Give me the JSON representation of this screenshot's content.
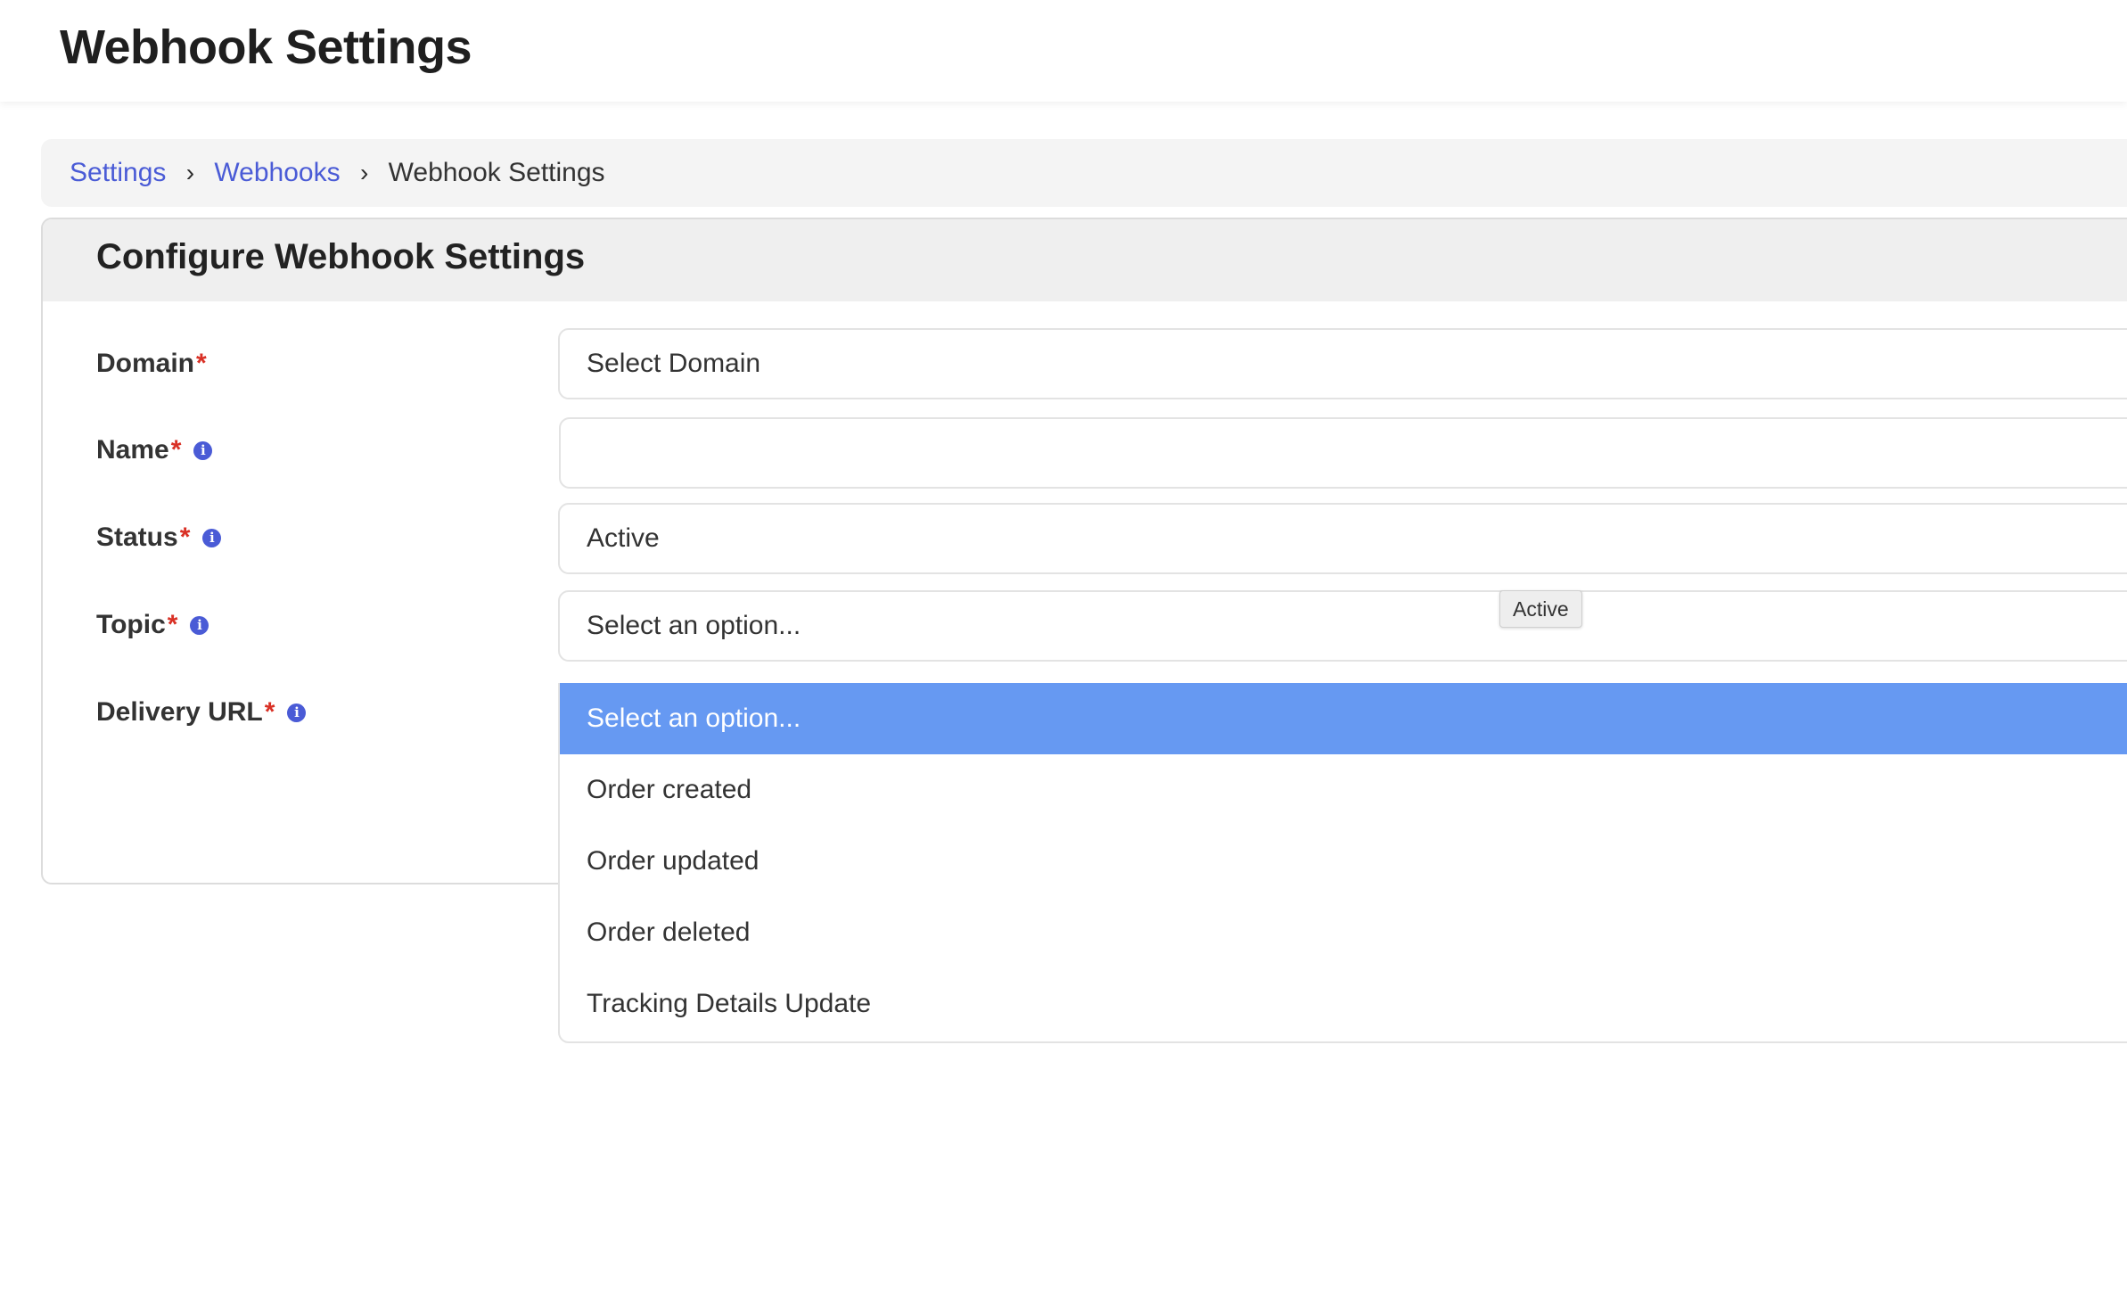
{
  "header": {
    "title": "Webhook Settings"
  },
  "breadcrumb": {
    "items": [
      {
        "label": "Settings",
        "link": true
      },
      {
        "label": "Webhooks",
        "link": true
      },
      {
        "label": "Webhook Settings",
        "link": false
      }
    ],
    "separator": "›"
  },
  "card": {
    "title": "Configure Webhook Settings"
  },
  "form": {
    "required_marker": "*",
    "info_glyph": "i",
    "fields": {
      "domain": {
        "label": "Domain",
        "value": "Select Domain"
      },
      "name": {
        "label": "Name",
        "value": ""
      },
      "status": {
        "label": "Status",
        "value": "Active"
      },
      "topic": {
        "label": "Topic",
        "value": "Select an option..."
      },
      "delivery_url": {
        "label": "Delivery URL"
      }
    }
  },
  "tooltip": {
    "text": "Active"
  },
  "topic_dropdown": {
    "options": [
      "Select an option...",
      "Order created",
      "Order updated",
      "Order deleted",
      "Tracking Details Update"
    ],
    "highlighted_index": 0
  },
  "colors": {
    "link": "#4a5bd6",
    "required": "#d93025",
    "info": "#4a5bd6",
    "highlight": "#6699f2"
  },
  "icons": {
    "info": "info-icon",
    "separator": "chevron-right-icon"
  }
}
